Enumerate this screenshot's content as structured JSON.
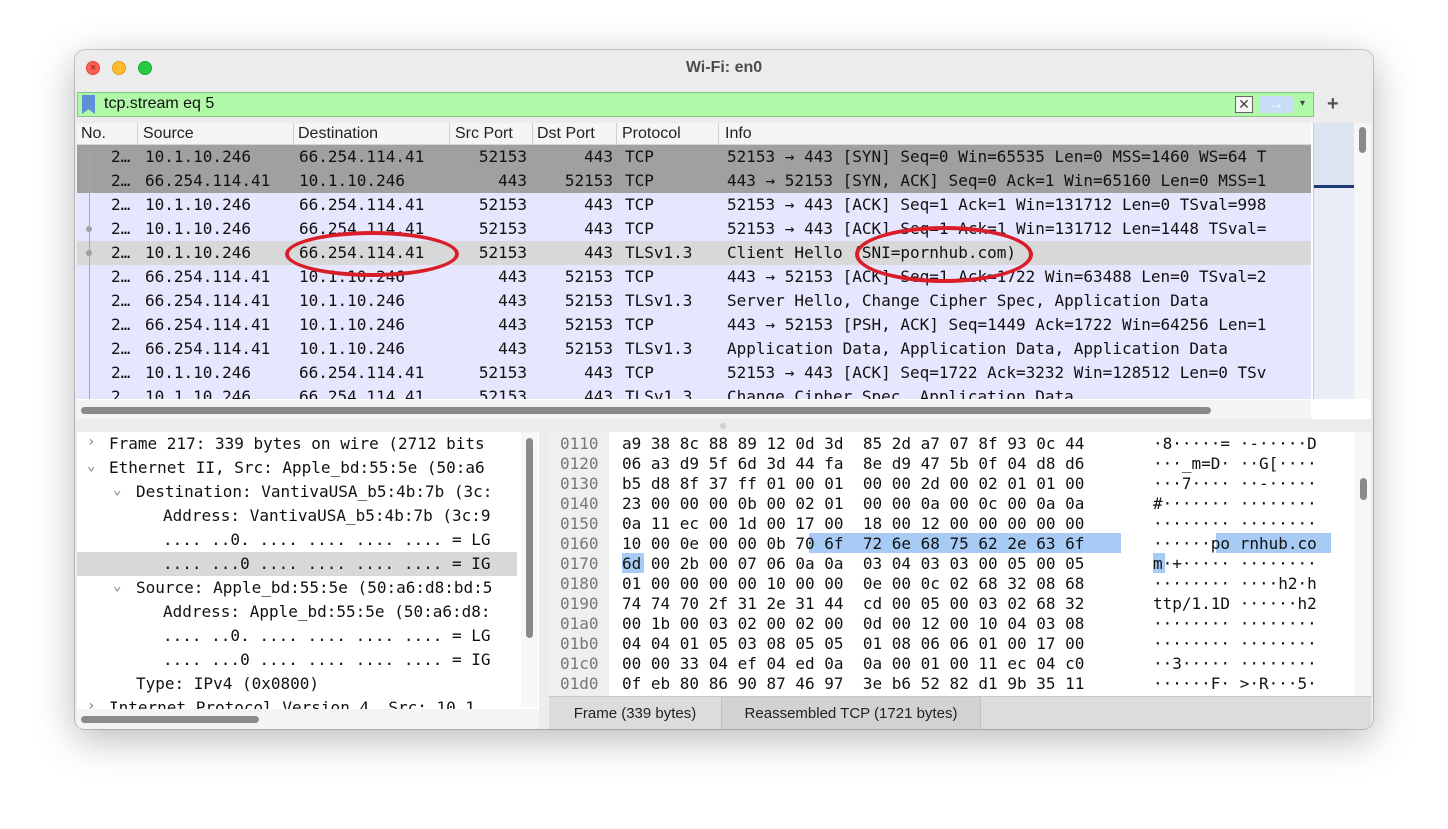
{
  "window": {
    "title": "Wi-Fi: en0"
  },
  "filter": {
    "value": "tcp.stream eq 5",
    "clear_glyph": "✕",
    "apply_glyph": "→",
    "dropdown_glyph": "▾",
    "add_glyph": "+"
  },
  "columns": [
    "No.",
    "Source",
    "Destination",
    "Src Port",
    "Dst Port",
    "Protocol",
    "Info"
  ],
  "packets": [
    {
      "no": "2…",
      "src": "10.1.10.246",
      "dst": "66.254.114.41",
      "sport": "52153",
      "dport": "443",
      "proto": "TCP",
      "info": "52153 → 443 [SYN] Seq=0 Win=65535 Len=0 MSS=1460 WS=64 T"
    },
    {
      "no": "2…",
      "src": "66.254.114.41",
      "dst": "10.1.10.246",
      "sport": "443",
      "dport": "52153",
      "proto": "TCP",
      "info": "443 → 52153 [SYN, ACK] Seq=0 Ack=1 Win=65160 Len=0 MSS=1"
    },
    {
      "no": "2…",
      "src": "10.1.10.246",
      "dst": "66.254.114.41",
      "sport": "52153",
      "dport": "443",
      "proto": "TCP",
      "info": "52153 → 443 [ACK] Seq=1 Ack=1 Win=131712 Len=0 TSval=998"
    },
    {
      "no": "2…",
      "src": "10.1.10.246",
      "dst": "66.254.114.41",
      "sport": "52153",
      "dport": "443",
      "proto": "TCP",
      "info": "52153 → 443 [ACK] Seq=1 Ack=1 Win=131712 Len=1448 TSval="
    },
    {
      "no": "2…",
      "src": "10.1.10.246",
      "dst": "66.254.114.41",
      "sport": "52153",
      "dport": "443",
      "proto": "TLSv1.3",
      "info": "Client Hello (SNI=pornhub.com)"
    },
    {
      "no": "2…",
      "src": "66.254.114.41",
      "dst": "10.1.10.246",
      "sport": "443",
      "dport": "52153",
      "proto": "TCP",
      "info": "443 → 52153 [ACK] Seq=1 Ack=1722 Win=63488 Len=0 TSval=2"
    },
    {
      "no": "2…",
      "src": "66.254.114.41",
      "dst": "10.1.10.246",
      "sport": "443",
      "dport": "52153",
      "proto": "TLSv1.3",
      "info": "Server Hello, Change Cipher Spec, Application Data"
    },
    {
      "no": "2…",
      "src": "66.254.114.41",
      "dst": "10.1.10.246",
      "sport": "443",
      "dport": "52153",
      "proto": "TCP",
      "info": "443 → 52153 [PSH, ACK] Seq=1449 Ack=1722 Win=64256 Len=1"
    },
    {
      "no": "2…",
      "src": "66.254.114.41",
      "dst": "10.1.10.246",
      "sport": "443",
      "dport": "52153",
      "proto": "TLSv1.3",
      "info": "Application Data, Application Data, Application Data"
    },
    {
      "no": "2…",
      "src": "10.1.10.246",
      "dst": "66.254.114.41",
      "sport": "52153",
      "dport": "443",
      "proto": "TCP",
      "info": "52153 → 443 [ACK] Seq=1722 Ack=3232 Win=128512 Len=0 TSv"
    },
    {
      "no": "2…",
      "src": "10.1.10.246",
      "dst": "66.254.114.41",
      "sport": "52153",
      "dport": "443",
      "proto": "TLSv1.3",
      "info": "Change Cipher Spec, Application Data"
    }
  ],
  "details": [
    {
      "arrow": "›",
      "text": "Frame 217: 339 bytes on wire (2712 bits"
    },
    {
      "arrow": "⌄",
      "text": "Ethernet II, Src: Apple_bd:55:5e (50:a6"
    },
    {
      "arrow": "⌄",
      "text": "Destination: VantivaUSA_b5:4b:7b (3c:"
    },
    {
      "arrow": "",
      "text": "Address: VantivaUSA_b5:4b:7b (3c:9"
    },
    {
      "arrow": "",
      "text": ".... ..0. .... .... .... .... = LG"
    },
    {
      "arrow": "",
      "text": ".... ...0 .... .... .... .... = IG"
    },
    {
      "arrow": "⌄",
      "text": "Source: Apple_bd:55:5e (50:a6:d8:bd:5"
    },
    {
      "arrow": "",
      "text": "Address: Apple_bd:55:5e (50:a6:d8:"
    },
    {
      "arrow": "",
      "text": ".... ..0. .... .... .... .... = LG"
    },
    {
      "arrow": "",
      "text": ".... ...0 .... .... .... .... = IG"
    },
    {
      "arrow": "",
      "text": "Type: IPv4 (0x0800)"
    },
    {
      "arrow": "›",
      "text": "Internet Protocol Version 4, Src: 10.1."
    }
  ],
  "bytes": [
    {
      "off": "0110",
      "hex": "a9 38 8c 88 89 12 0d 3d  85 2d a7 07 8f 93 0c 44",
      "ascii": "·8·····= ·-·····D"
    },
    {
      "off": "0120",
      "hex": "06 a3 d9 5f 6d 3d 44 fa  8e d9 47 5b 0f 04 d8 d6",
      "ascii": "···_m=D· ··G[····"
    },
    {
      "off": "0130",
      "hex": "b5 d8 8f 37 ff 01 00 01  00 00 2d 00 02 01 01 00",
      "ascii": "···7···· ··-·····"
    },
    {
      "off": "0140",
      "hex": "23 00 00 00 0b 00 02 01  00 00 0a 00 0c 00 0a 0a",
      "ascii": "#······· ········"
    },
    {
      "off": "0150",
      "hex": "0a 11 ec 00 1d 00 17 00  18 00 12 00 00 00 00 00",
      "ascii": "········ ········"
    },
    {
      "off": "0160",
      "hex": "10 00 0e 00 00 0b 70 6f  72 6e 68 75 62 2e 63 6f",
      "ascii": "······po rnhub.co"
    },
    {
      "off": "0170",
      "hex": "6d 00 2b 00 07 06 0a 0a  03 04 03 03 00 05 00 05",
      "ascii": "m·+····· ········"
    },
    {
      "off": "0180",
      "hex": "01 00 00 00 00 10 00 00  0e 00 0c 02 68 32 08 68",
      "ascii": "········ ····h2·h"
    },
    {
      "off": "0190",
      "hex": "74 74 70 2f 31 2e 31 44  cd 00 05 00 03 02 68 32",
      "ascii": "ttp/1.1D ······h2"
    },
    {
      "off": "01a0",
      "hex": "00 1b 00 03 02 00 02 00  0d 00 12 00 10 04 03 08",
      "ascii": "········ ········"
    },
    {
      "off": "01b0",
      "hex": "04 04 01 05 03 08 05 05  01 08 06 06 01 00 17 00",
      "ascii": "········ ········"
    },
    {
      "off": "01c0",
      "hex": "00 00 33 04 ef 04 ed 0a  0a 00 01 00 11 ec 04 c0",
      "ascii": "··3····· ········"
    },
    {
      "off": "01d0",
      "hex": "0f eb 80 86 90 87 46 97  3e b6 52 82 d1 9b 35 11",
      "ascii": "······F· >·R···5·"
    }
  ],
  "byte_tabs": [
    "Frame (339 bytes)",
    "Reassembled TCP (1721 bytes)"
  ],
  "colors": {
    "filter_ok": "#b0f9a8",
    "row_tcp": "#e7e6ff",
    "row_syn": "#a0a0a0",
    "selected": "#d8d8d8",
    "highlight": "#a7cbf4",
    "annotation": "#d91e2a"
  }
}
